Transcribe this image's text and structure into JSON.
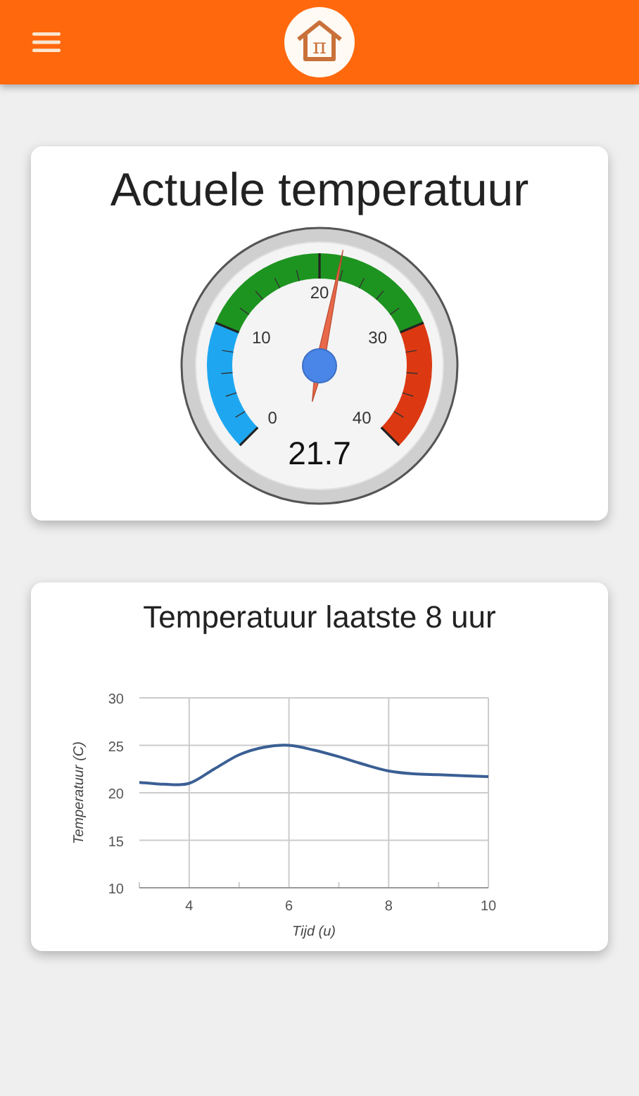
{
  "header": {
    "logo_symbol": "π"
  },
  "gauge_card": {
    "title": "Actuele temperatuur",
    "gauge": {
      "reading": "21.7",
      "labels": [
        "0",
        "10",
        "20",
        "30",
        "40"
      ],
      "zones": [
        {
          "color": "#1ea7f0"
        },
        {
          "color": "#1e9420"
        },
        {
          "color": "#dc3912"
        }
      ]
    }
  },
  "chart_card": {
    "title": "Temperatuur laatste 8 uur",
    "chart_data": {
      "type": "line",
      "xlabel": "Tijd (u)",
      "ylabel": "Temperatuur (C)",
      "x": [
        3,
        3.5,
        4,
        4.5,
        5,
        5.5,
        6,
        6.5,
        7,
        7.5,
        8,
        8.5,
        9,
        9.5,
        10
      ],
      "grid": true,
      "series": [
        {
          "color": "#3a5f94",
          "values": [
            21.1,
            20.9,
            21.0,
            22.5,
            24.0,
            24.8,
            25.0,
            24.5,
            23.8,
            23.0,
            22.3,
            22.0,
            21.9,
            21.8,
            21.7
          ]
        }
      ],
      "xlim": [
        3,
        10
      ],
      "ylim": [
        10,
        30
      ],
      "xticks": [
        4,
        6,
        8,
        10
      ],
      "yticks": [
        10,
        15,
        20,
        25,
        30
      ]
    }
  }
}
